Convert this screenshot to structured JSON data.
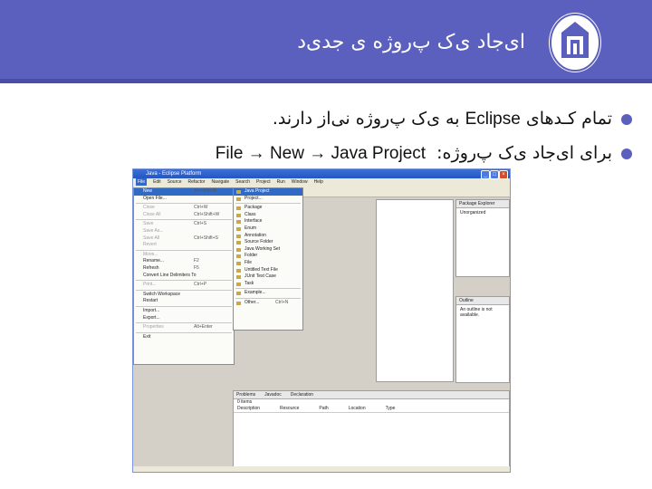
{
  "slide": {
    "title": "ای‌جاد ی‌ک پ‌روژه ی جدی‌د",
    "bullets": [
      {
        "text_rtl_before": "تمام کـدهای",
        "text_ltr": "Eclipse",
        "text_rtl_after": "به ی‌ک پ‌روژه نی‌از دارند."
      },
      {
        "text_rtl": "برای ای‌جاد ی‌ک پ‌روژه:",
        "text_ltr": "File → New → Java Project"
      }
    ],
    "accent_color": "#5b5fbd"
  },
  "eclipse": {
    "window_title": "Java - Eclipse Platform",
    "menubar": [
      "File",
      "Edit",
      "Source",
      "Refactor",
      "Navigate",
      "Search",
      "Project",
      "Run",
      "Window",
      "Help"
    ],
    "file_menu": [
      {
        "label": "New",
        "shortcut": "Alt+Shift+N",
        "selected": true
      },
      {
        "label": "Open File...",
        "shortcut": ""
      },
      {
        "sep": true
      },
      {
        "label": "Close",
        "shortcut": "Ctrl+W",
        "disabled": true
      },
      {
        "label": "Close All",
        "shortcut": "Ctrl+Shift+W",
        "disabled": true
      },
      {
        "sep": true
      },
      {
        "label": "Save",
        "shortcut": "Ctrl+S",
        "disabled": true
      },
      {
        "label": "Save As...",
        "shortcut": "",
        "disabled": true
      },
      {
        "label": "Save All",
        "shortcut": "Ctrl+Shift+S",
        "disabled": true
      },
      {
        "label": "Revert",
        "shortcut": "",
        "disabled": true
      },
      {
        "sep": true
      },
      {
        "label": "Move...",
        "shortcut": "",
        "disabled": true
      },
      {
        "label": "Rename...",
        "shortcut": "F2"
      },
      {
        "label": "Refresh",
        "shortcut": "F5"
      },
      {
        "label": "Convert Line Delimiters To",
        "shortcut": ""
      },
      {
        "sep": true
      },
      {
        "label": "Print...",
        "shortcut": "Ctrl+P",
        "disabled": true
      },
      {
        "sep": true
      },
      {
        "label": "Switch Workspace",
        "shortcut": ""
      },
      {
        "label": "Restart",
        "shortcut": ""
      },
      {
        "sep": true
      },
      {
        "label": "Import...",
        "shortcut": ""
      },
      {
        "label": "Export...",
        "shortcut": ""
      },
      {
        "sep": true
      },
      {
        "label": "Properties",
        "shortcut": "Alt+Enter",
        "disabled": true
      },
      {
        "sep": true
      },
      {
        "label": "Exit",
        "shortcut": ""
      }
    ],
    "new_menu": [
      {
        "label": "Java Project",
        "selected": true
      },
      {
        "label": "Project..."
      },
      {
        "sep": true
      },
      {
        "label": "Package"
      },
      {
        "label": "Class"
      },
      {
        "label": "Interface"
      },
      {
        "label": "Enum"
      },
      {
        "label": "Annotation"
      },
      {
        "label": "Source Folder"
      },
      {
        "label": "Java Working Set"
      },
      {
        "label": "Folder"
      },
      {
        "label": "File"
      },
      {
        "label": "Untitled Text File"
      },
      {
        "label": "JUnit Test Case"
      },
      {
        "label": "Task"
      },
      {
        "sep": true
      },
      {
        "label": "Example..."
      },
      {
        "sep": true
      },
      {
        "label": "Other...",
        "shortcut": "Ctrl+N"
      }
    ],
    "project_view": {
      "tab": "Package Explorer",
      "item": "Unorganized"
    },
    "outline_view": {
      "tab": "Outline",
      "message": "An outline is not available."
    },
    "bottom_tabs": [
      "Problems",
      "Javadoc",
      "Declaration"
    ],
    "problems": {
      "summary": "0 items",
      "columns": [
        "Description",
        "Resource",
        "Path",
        "Location",
        "Type"
      ]
    }
  }
}
